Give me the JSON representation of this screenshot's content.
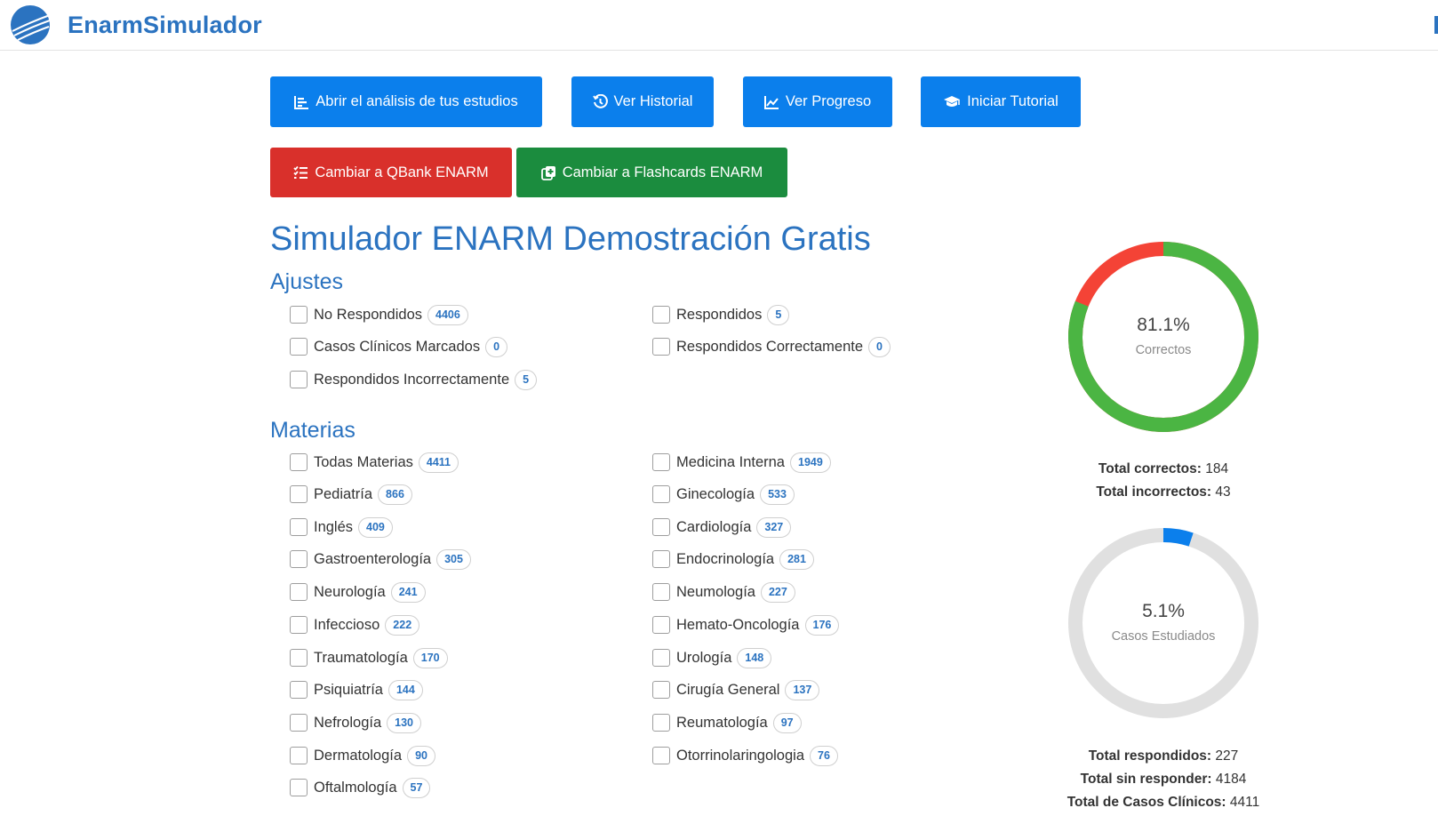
{
  "brand": {
    "name": "EnarmSimulador"
  },
  "toolbar": {
    "analysis": "Abrir el análisis de tus estudios",
    "history": "Ver Historial",
    "progress": "Ver Progreso",
    "tutorial": "Iniciar Tutorial",
    "qbank": "Cambiar a QBank ENARM",
    "flashcards": "Cambiar a Flashcards ENARM"
  },
  "page": {
    "title": "Simulador ENARM Demostración Gratis"
  },
  "ajustes": {
    "heading": "Ajustes",
    "items": [
      {
        "label": "No Respondidos",
        "count": "4406"
      },
      {
        "label": "Respondidos",
        "count": "5"
      },
      {
        "label": "Casos Clínicos Marcados",
        "count": "0"
      },
      {
        "label": "Respondidos Correctamente",
        "count": "0"
      },
      {
        "label": "Respondidos Incorrectamente",
        "count": "5"
      }
    ]
  },
  "materias": {
    "heading": "Materias",
    "items": [
      {
        "label": "Todas Materias",
        "count": "4411"
      },
      {
        "label": "Medicina Interna",
        "count": "1949"
      },
      {
        "label": "Pediatría",
        "count": "866"
      },
      {
        "label": "Ginecología",
        "count": "533"
      },
      {
        "label": "Inglés",
        "count": "409"
      },
      {
        "label": "Cardiología",
        "count": "327"
      },
      {
        "label": "Gastroenterología",
        "count": "305"
      },
      {
        "label": "Endocrinología",
        "count": "281"
      },
      {
        "label": "Neurología",
        "count": "241"
      },
      {
        "label": "Neumología",
        "count": "227"
      },
      {
        "label": "Infeccioso",
        "count": "222"
      },
      {
        "label": "Hemato-Oncología",
        "count": "176"
      },
      {
        "label": "Traumatología",
        "count": "170"
      },
      {
        "label": "Urología",
        "count": "148"
      },
      {
        "label": "Psiquiatría",
        "count": "144"
      },
      {
        "label": "Cirugía General",
        "count": "137"
      },
      {
        "label": "Nefrología",
        "count": "130"
      },
      {
        "label": "Reumatología",
        "count": "97"
      },
      {
        "label": "Dermatología",
        "count": "90"
      },
      {
        "label": "Otorrinolaringologia",
        "count": "76"
      },
      {
        "label": "Oftalmología",
        "count": "57"
      }
    ]
  },
  "stats": {
    "correct_chart": {
      "percent_text": "81.1%",
      "label": "Correctos",
      "fraction": 0.811,
      "fill_color": "#4bb543",
      "rest_color": "#f44336"
    },
    "total_correct_label": "Total correctos:",
    "total_correct_value": "184",
    "total_incorrect_label": "Total incorrectos:",
    "total_incorrect_value": "43",
    "studied_chart": {
      "percent_text": "5.1%",
      "label": "Casos Estudiados",
      "fraction": 0.051,
      "fill_color": "#0b7fec",
      "rest_color": "#e0e0e0"
    },
    "total_answered_label": "Total respondidos:",
    "total_answered_value": "227",
    "total_unanswered_label": "Total sin responder:",
    "total_unanswered_value": "4184",
    "total_cases_label": "Total de Casos Clínicos:",
    "total_cases_value": "4411"
  }
}
